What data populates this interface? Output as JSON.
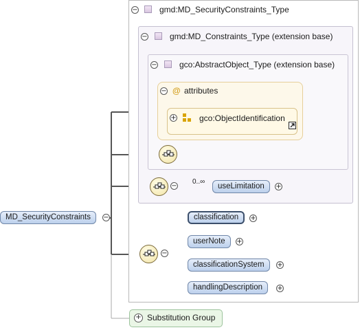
{
  "root": {
    "name": "MD_SecurityConstraints",
    "type": "gmd:MD_SecurityConstraints_Type"
  },
  "extensions": [
    "gmd:MD_Constraints_Type (extension base)",
    "gco:AbstractObject_Type (extension base)"
  ],
  "attributes": {
    "label": "attributes",
    "symbol": "@",
    "group_name": "gco:ObjectIdentification"
  },
  "use_limitation": {
    "name": "useLimitation",
    "cardinality": "0..∞"
  },
  "elements": [
    "classification",
    "userNote",
    "classificationSystem",
    "handlingDescription"
  ],
  "substitution_group": "Substitution Group",
  "toggles": {
    "collapse": "−",
    "expand": "+"
  }
}
